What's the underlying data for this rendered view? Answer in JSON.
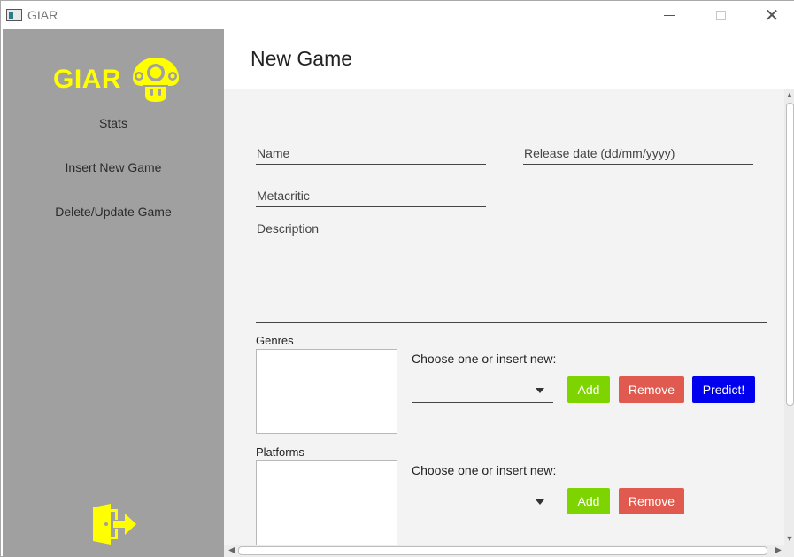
{
  "window": {
    "title": "GIAR",
    "minimize_icon": "minimize-icon",
    "maximize_icon": "maximize-icon",
    "close_icon": "close-icon",
    "close_glyph": "✕"
  },
  "sidebar": {
    "logo_text": "GIAR",
    "logo_icon": "mushroom-icon",
    "items": [
      {
        "label": "Stats"
      },
      {
        "label": "Insert New Game"
      },
      {
        "label": "Delete/Update Game"
      }
    ],
    "logout_icon": "logout-icon"
  },
  "header": {
    "title": "New Game"
  },
  "form": {
    "name_placeholder": "Name",
    "release_date_placeholder": "Release date (dd/mm/yyyy)",
    "metacritic_placeholder": "Metacritic",
    "description_placeholder": "Description",
    "genres": {
      "label": "Genres",
      "choose_label": "Choose one or insert new:",
      "combo_value": "",
      "add_label": "Add",
      "remove_label": "Remove",
      "predict_label": "Predict!"
    },
    "platforms": {
      "label": "Platforms",
      "choose_label": "Choose one or insert new:",
      "combo_value": "",
      "add_label": "Add",
      "remove_label": "Remove"
    }
  },
  "colors": {
    "sidebar_bg": "#a0a0a0",
    "logo_yellow": "#ffff00",
    "add_green": "#7ed400",
    "remove_red": "#e05a4f",
    "predict_blue": "#0000ee",
    "content_bg": "#f3f3f3"
  }
}
